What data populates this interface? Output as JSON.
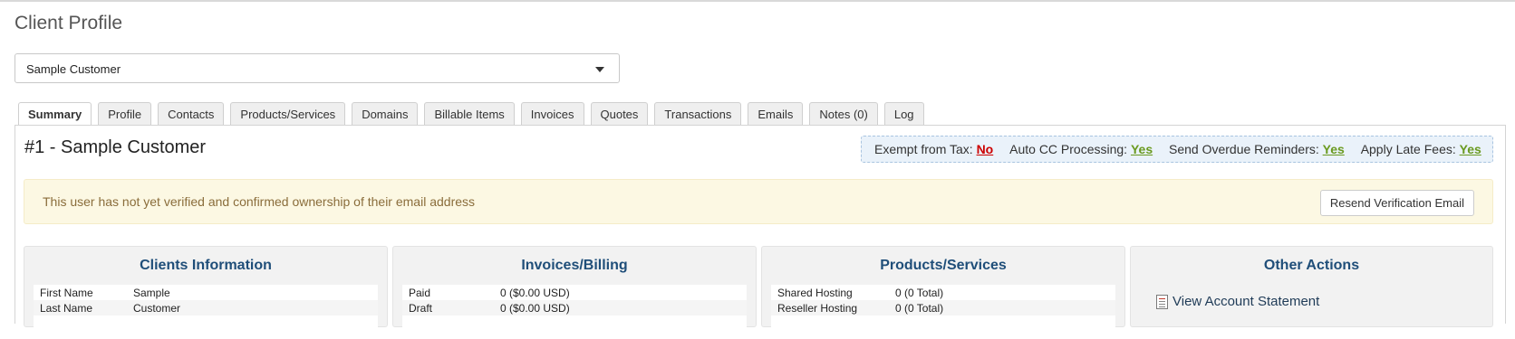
{
  "page": {
    "title": "Client Profile"
  },
  "client_select": {
    "value": "Sample Customer"
  },
  "tabs": [
    {
      "label": "Summary",
      "active": true
    },
    {
      "label": "Profile"
    },
    {
      "label": "Contacts"
    },
    {
      "label": "Products/Services"
    },
    {
      "label": "Domains"
    },
    {
      "label": "Billable Items"
    },
    {
      "label": "Invoices"
    },
    {
      "label": "Quotes"
    },
    {
      "label": "Transactions"
    },
    {
      "label": "Emails"
    },
    {
      "label": "Notes (0)"
    },
    {
      "label": "Log"
    }
  ],
  "client": {
    "heading": "#1 - Sample Customer"
  },
  "flags": [
    {
      "label": "Exempt from Tax:",
      "value": "No"
    },
    {
      "label": "Auto CC Processing:",
      "value": "Yes"
    },
    {
      "label": "Send Overdue Reminders:",
      "value": "Yes"
    },
    {
      "label": "Apply Late Fees:",
      "value": "Yes"
    }
  ],
  "alert": {
    "message": "This user has not yet verified and confirmed ownership of their email address",
    "button_label": "Resend Verification Email"
  },
  "panels": {
    "clients_info": {
      "title": "Clients Information",
      "rows": [
        {
          "label": "First Name",
          "value": "Sample"
        },
        {
          "label": "Last Name",
          "value": "Customer"
        }
      ]
    },
    "invoices_billing": {
      "title": "Invoices/Billing",
      "rows": [
        {
          "label": "Paid",
          "value": "0 ($0.00 USD)"
        },
        {
          "label": "Draft",
          "value": "0 ($0.00 USD)"
        }
      ]
    },
    "products_services": {
      "title": "Products/Services",
      "rows": [
        {
          "label": "Shared Hosting",
          "value": "0 (0 Total)"
        },
        {
          "label": "Reseller Hosting",
          "value": "0 (0 Total)"
        }
      ]
    },
    "other_actions": {
      "title": "Other Actions",
      "items": [
        {
          "label": "View Account Statement"
        }
      ]
    }
  },
  "colors": {
    "panel_title": "#1f4e79",
    "flag_no": "#cc0000",
    "flag_yes": "#6a9a1f",
    "alert_bg": "#fcf8e3",
    "alert_text": "#8a6d3b"
  },
  "icons": {
    "select_caret": "chevron-down-icon",
    "statement": "statement-icon"
  }
}
